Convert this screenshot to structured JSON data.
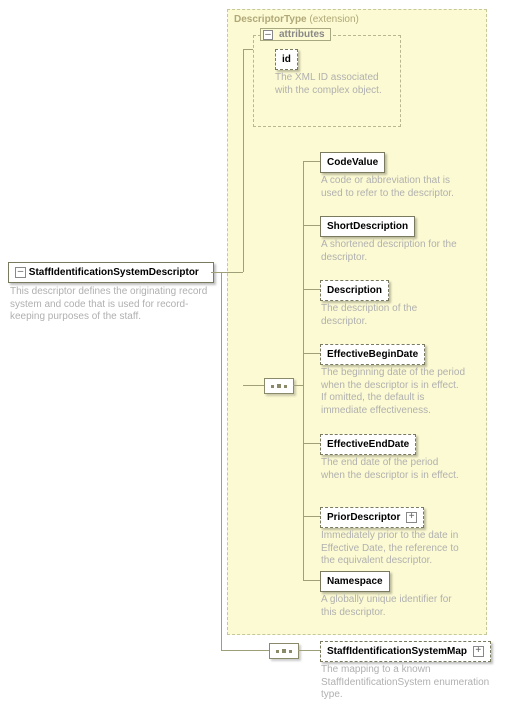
{
  "root": {
    "label": "StaffIdentificationSystemDescriptor",
    "desc": "This descriptor defines the originating record system and code that is used for record-keeping purposes of the staff."
  },
  "extension": {
    "label": "DescriptorType",
    "suffix": " (extension)"
  },
  "attributes": {
    "legend": "attributes",
    "id": {
      "label": "id",
      "desc": "The XML ID associated with the complex object."
    }
  },
  "children": {
    "codeValue": {
      "label": "CodeValue",
      "desc": "A code or abbreviation that is used to refer to the descriptor."
    },
    "shortDescription": {
      "label": "ShortDescription",
      "desc": "A shortened description for the descriptor."
    },
    "description": {
      "label": "Description",
      "desc": "The description of the descriptor."
    },
    "effectiveBeginDate": {
      "label": "EffectiveBeginDate",
      "desc": "The beginning date of the period when the descriptor is in effect. If omitted, the default is immediate effectiveness."
    },
    "effectiveEndDate": {
      "label": "EffectiveEndDate",
      "desc": "The end date of the period when the descriptor is in effect."
    },
    "priorDescriptor": {
      "label": "PriorDescriptor",
      "desc": "Immediately prior to the date in Effective Date, the reference to the equivalent descriptor."
    },
    "namespace": {
      "label": "Namespace",
      "desc": "A globally unique identifier for this descriptor."
    }
  },
  "map": {
    "label": "StaffIdentificationSystemMap",
    "desc": "The mapping to a known StaffIdentificationSystem enumeration type."
  }
}
